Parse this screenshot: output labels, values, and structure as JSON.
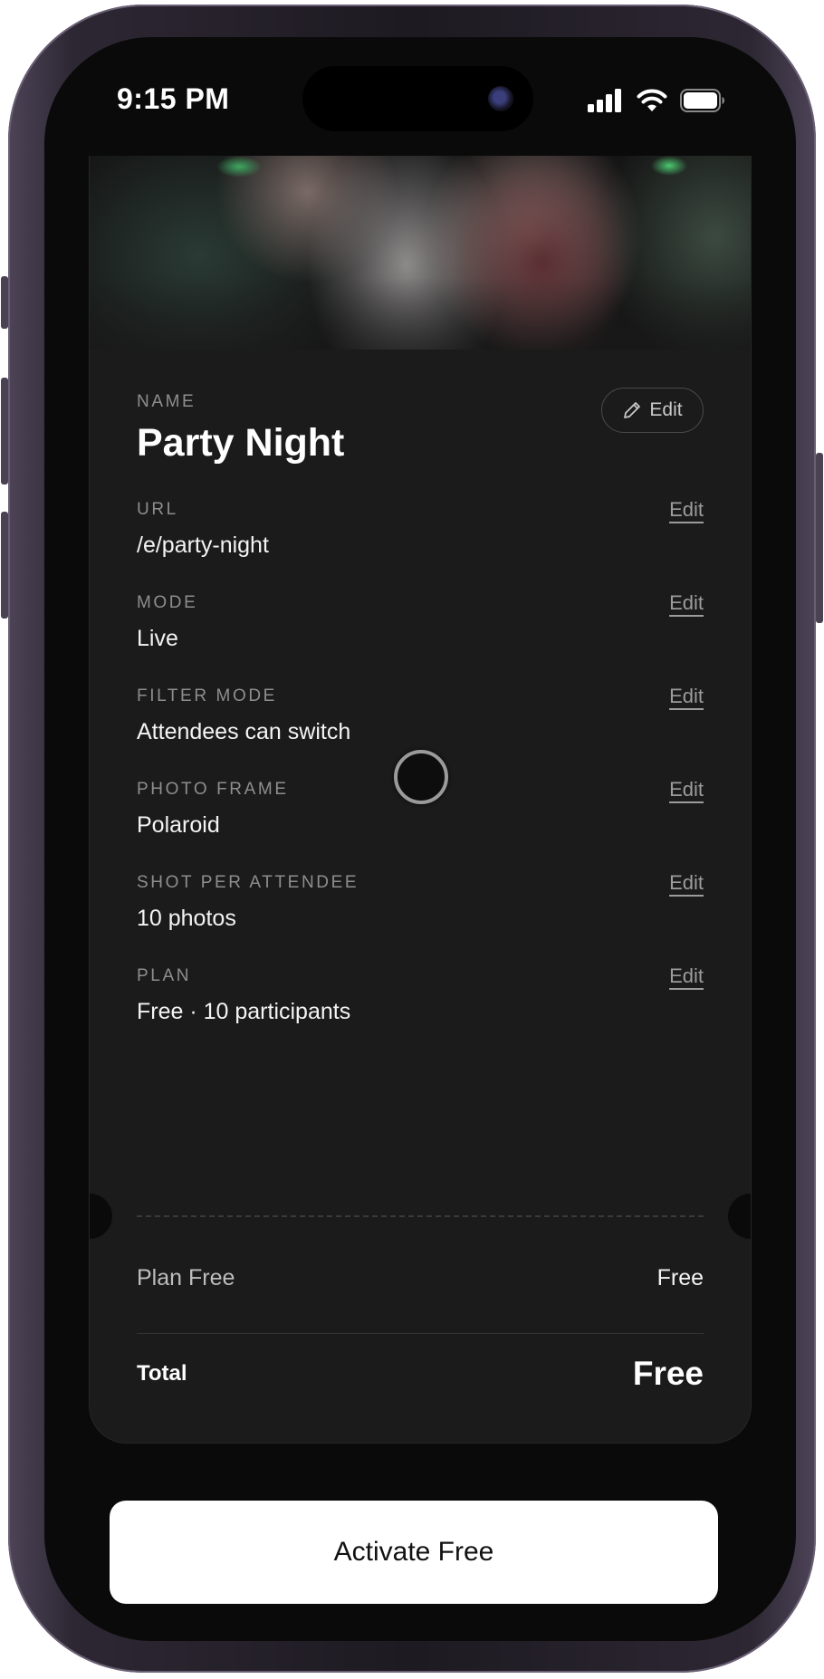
{
  "status_bar": {
    "time": "9:15 PM"
  },
  "event": {
    "name_label": "NAME",
    "name": "Party Night",
    "name_edit_label": "Edit",
    "fields": [
      {
        "label": "URL",
        "value": "/e/party-night",
        "edit_label": "Edit"
      },
      {
        "label": "MODE",
        "value": "Live",
        "edit_label": "Edit"
      },
      {
        "label": "FILTER MODE",
        "value": "Attendees can switch",
        "edit_label": "Edit"
      },
      {
        "label": "PHOTO FRAME",
        "value": "Polaroid",
        "edit_label": "Edit"
      },
      {
        "label": "SHOT PER ATTENDEE",
        "value": "10 photos",
        "edit_label": "Edit"
      },
      {
        "label": "PLAN",
        "value": "Free · 10 participants",
        "edit_label": "Edit"
      }
    ]
  },
  "summary": {
    "plan_label": "Plan Free",
    "plan_price": "Free",
    "total_label": "Total",
    "total_price": "Free"
  },
  "cta": {
    "label": "Activate Free"
  },
  "colors": {
    "background": "#0a0a0a",
    "card": "#1b1b1b",
    "label": "#8e8e8e",
    "cta_bg": "#ffffff"
  },
  "icons": {
    "edit": "pencil-icon",
    "signal": "cellular-signal-icon",
    "wifi": "wifi-icon",
    "battery": "battery-icon"
  }
}
